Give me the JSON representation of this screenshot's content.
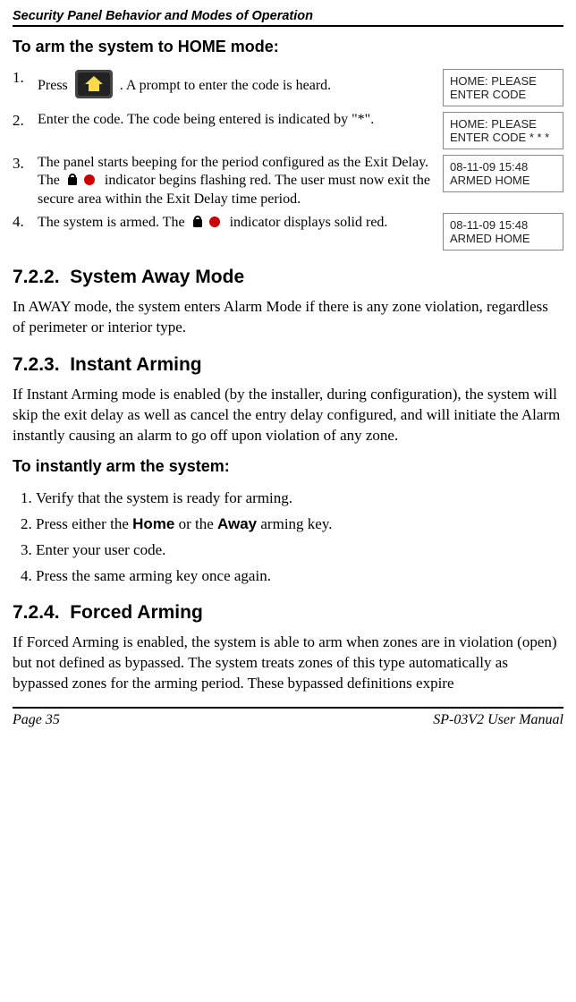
{
  "runningHeader": "Security Panel Behavior and Modes of Operation",
  "sectionArm": {
    "title": "To arm the system to HOME mode:",
    "steps": {
      "s1a": "Press ",
      "s1b": " . A prompt to enter the code is heard.",
      "s2": "Enter the code. The code being entered is indicated by \"*\".",
      "s3a": "The panel starts beeping for the period configured as the Exit Delay. The ",
      "s3b": " indicator begins flashing red. The user must now exit the secure area within the Exit Delay time period.",
      "s4a": "The system is armed. The ",
      "s4b": " indicator displays solid red."
    },
    "panels": {
      "p1": "HOME: PLEASE ENTER CODE",
      "p2": "HOME: PLEASE ENTER CODE * * *",
      "p3": "08-11-09 15:48 ARMED HOME",
      "p4": "08-11-09 15:48 ARMED HOME"
    }
  },
  "sec722": {
    "num": "7.2.2.",
    "title": "System Away Mode",
    "body": "In AWAY mode, the system enters Alarm Mode if there is any zone violation, regardless of perimeter or interior type."
  },
  "sec723": {
    "num": "7.2.3.",
    "title": "Instant Arming",
    "body": "If Instant Arming mode is enabled (by the installer, during configuration), the system will skip the exit delay as well as cancel the entry delay configured, and will initiate the Alarm instantly causing an alarm to go off upon violation of any zone.",
    "sub": "To instantly arm the system:",
    "steps": {
      "s1": "Verify that the system is ready for arming.",
      "s2a": "Press either the ",
      "s2home": "Home",
      "s2b": " or the ",
      "s2away": "Away",
      "s2c": " arming key.",
      "s3": "Enter your user code.",
      "s4": "Press the same arming key once again."
    }
  },
  "sec724": {
    "num": "7.2.4.",
    "title": "Forced Arming",
    "body": "If Forced Arming is enabled, the system is able to arm when zones are in violation (open) but not defined as bypassed. The system treats zones of this type automatically as bypassed zones for the arming period. These bypassed definitions expire"
  },
  "footer": {
    "left": "Page 35",
    "right": "SP-03V2 User Manual"
  }
}
